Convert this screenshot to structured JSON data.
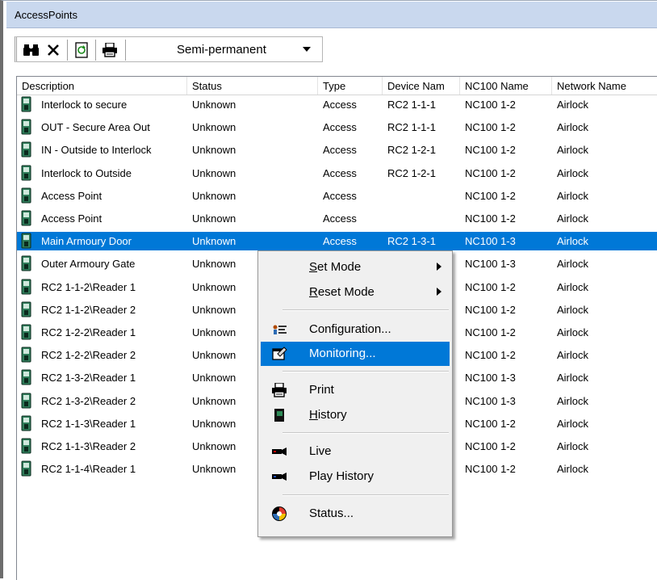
{
  "window": {
    "title": "AccessPoints"
  },
  "toolbar": {
    "find_icon": "binoculars-icon",
    "delete_icon": "delete-x-icon",
    "refresh_icon": "refresh-icon",
    "print_icon": "printer-icon",
    "mode_value": "Semi-permanent"
  },
  "columns": [
    "Description",
    "Status",
    "Type",
    "Device Nam",
    "NC100 Name",
    "Network Name"
  ],
  "rows": [
    {
      "description": "Interlock to secure",
      "status": "Unknown",
      "type": "Access",
      "device": "RC2 1-1-1",
      "nc100": "NC100 1-2",
      "network": "Airlock"
    },
    {
      "description": "OUT - Secure Area Out",
      "status": "Unknown",
      "type": "Access",
      "device": "RC2 1-1-1",
      "nc100": "NC100 1-2",
      "network": "Airlock"
    },
    {
      "description": "IN - Outside to Interlock",
      "status": "Unknown",
      "type": "Access",
      "device": "RC2 1-2-1",
      "nc100": "NC100 1-2",
      "network": "Airlock"
    },
    {
      "description": "Interlock to Outside",
      "status": "Unknown",
      "type": "Access",
      "device": "RC2 1-2-1",
      "nc100": "NC100 1-2",
      "network": "Airlock"
    },
    {
      "description": "Access Point",
      "status": "Unknown",
      "type": "Access",
      "device": "",
      "nc100": "NC100 1-2",
      "network": "Airlock"
    },
    {
      "description": "Access Point",
      "status": "Unknown",
      "type": "Access",
      "device": "",
      "nc100": "NC100 1-2",
      "network": "Airlock"
    },
    {
      "description": "Main Armoury Door",
      "status": "Unknown",
      "type": "Access",
      "device": "RC2 1-3-1",
      "nc100": "NC100 1-3",
      "network": "Airlock",
      "selected": true
    },
    {
      "description": "Outer Armoury Gate",
      "status": "Unknown",
      "type": "",
      "device": "",
      "nc100": "NC100 1-3",
      "network": "Airlock"
    },
    {
      "description": "RC2 1-1-2\\Reader 1",
      "status": "Unknown",
      "type": "",
      "device": "",
      "nc100": "NC100 1-2",
      "network": "Airlock"
    },
    {
      "description": "RC2 1-1-2\\Reader 2",
      "status": "Unknown",
      "type": "",
      "device": "",
      "nc100": "NC100 1-2",
      "network": "Airlock"
    },
    {
      "description": "RC2 1-2-2\\Reader 1",
      "status": "Unknown",
      "type": "",
      "device": "",
      "nc100": "NC100 1-2",
      "network": "Airlock"
    },
    {
      "description": "RC2 1-2-2\\Reader 2",
      "status": "Unknown",
      "type": "",
      "device": "",
      "nc100": "NC100 1-2",
      "network": "Airlock"
    },
    {
      "description": "RC2 1-3-2\\Reader 1",
      "status": "Unknown",
      "type": "",
      "device": "",
      "nc100": "NC100 1-3",
      "network": "Airlock"
    },
    {
      "description": "RC2 1-3-2\\Reader 2",
      "status": "Unknown",
      "type": "",
      "device": "",
      "nc100": "NC100 1-3",
      "network": "Airlock"
    },
    {
      "description": "RC2 1-1-3\\Reader 1",
      "status": "Unknown",
      "type": "",
      "device": "",
      "nc100": "NC100 1-2",
      "network": "Airlock"
    },
    {
      "description": "RC2 1-1-3\\Reader 2",
      "status": "Unknown",
      "type": "",
      "device": "",
      "nc100": "NC100 1-2",
      "network": "Airlock"
    },
    {
      "description": "RC2 1-1-4\\Reader 1",
      "status": "Unknown",
      "type": "",
      "device": "",
      "nc100": "NC100 1-2",
      "network": "Airlock"
    }
  ],
  "context_menu": {
    "set_mode": {
      "pre": "",
      "mn": "S",
      "post": "et Mode"
    },
    "reset_mode": {
      "pre": "",
      "mn": "R",
      "post": "eset Mode"
    },
    "configuration": "Configuration...",
    "monitoring": "Monitoring...",
    "print": "Print",
    "history": {
      "pre": "",
      "mn": "H",
      "post": "istory"
    },
    "live": "Live",
    "play_history": "Play History",
    "status": "Status...",
    "highlighted_item": "Monitoring..."
  },
  "colors": {
    "selection": "#0078d7",
    "titlebar": "#c9d8ee",
    "menu_bg": "#f0f0f0"
  }
}
